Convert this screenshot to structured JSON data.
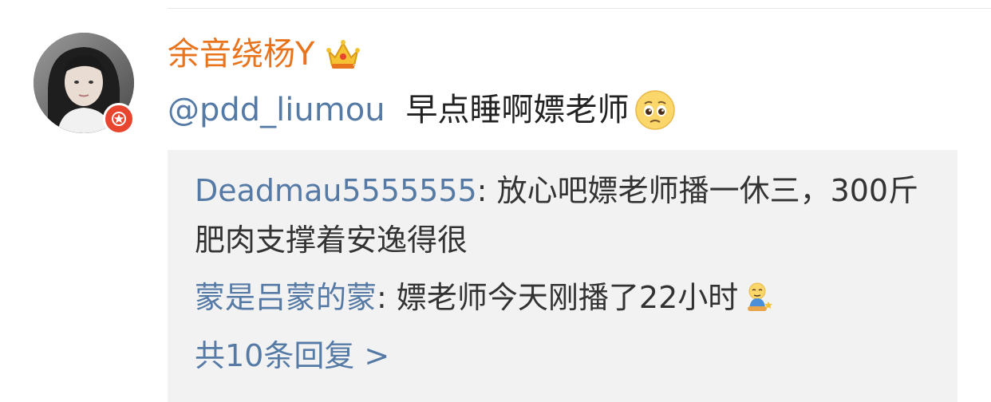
{
  "comment": {
    "username": "余音绕杨Y",
    "username_color": "#e8741e",
    "mention": "@pdd_liumou",
    "text": "早点睡啊嫖老师",
    "link_color": "#557aa5",
    "icons": [
      "vip-crown-icon",
      "pleading-face-emoji",
      "verified-badge-icon"
    ]
  },
  "replies": [
    {
      "name": "Deadmau5555555",
      "separator": ": ",
      "text": "放心吧嫖老师播一休三，300斤肥肉支撑着安逸得很"
    },
    {
      "name": "蒙是吕蒙的蒙",
      "separator": ": ",
      "text": "嫖老师今天刚播了22小时",
      "emoji": "relieved-figure-emoji"
    }
  ],
  "view_more": "共10条回复 >"
}
